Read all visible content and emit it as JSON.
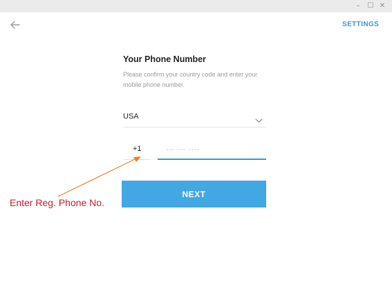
{
  "window": {
    "minimize_icon": "minimize-icon",
    "maximize_icon": "maximize-icon",
    "close_icon": "close-icon",
    "minimize_glyph": "–",
    "maximize_glyph": "☐",
    "close_glyph": "✕"
  },
  "header": {
    "back_icon": "back-arrow-icon",
    "settings_label": "SETTINGS"
  },
  "form": {
    "title": "Your Phone Number",
    "description": "Please confirm your country code and enter your mobile phone number.",
    "country": "USA",
    "country_chevron_icon": "chevron-down-icon",
    "country_code": "+1",
    "phone_placeholder": "--- --- ----",
    "phone_value": "",
    "next_label": "NEXT"
  },
  "annotation": {
    "text": "Enter Reg. Phone No.",
    "color": "#c0202a",
    "arrow_color": "#e8812f"
  },
  "colors": {
    "accent": "#3a95d8",
    "button": "#42a7e2"
  }
}
